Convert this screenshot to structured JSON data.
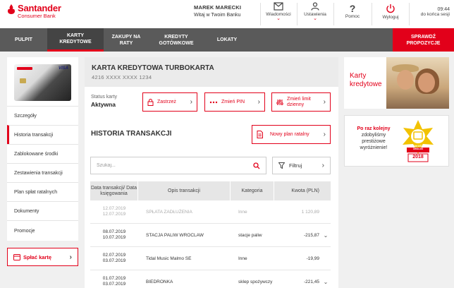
{
  "brand": {
    "name": "Santander",
    "subtitle": "Consumer Bank",
    "accent": "#e2001a"
  },
  "user": {
    "name": "MAREK MARECKI",
    "welcome": "Witaj w Twoim Banku"
  },
  "topbar": {
    "messages": "Wiadomości",
    "settings": "Ustawienia",
    "help": "Pomoc",
    "logout": "Wyloguj",
    "time": "09:44",
    "session_label": "do końca sesji"
  },
  "nav": {
    "items": [
      {
        "label": "PULPIT"
      },
      {
        "label": "KARTY KREDYTOWE"
      },
      {
        "label": "ZAKUPY NA RATY"
      },
      {
        "label": "KREDYTY GOTÓWKOWE"
      },
      {
        "label": "LOKATY"
      }
    ],
    "cta": "SPRAWDŹ PROPOZYCJE"
  },
  "sidebar": {
    "items": [
      {
        "label": "Szczegóły"
      },
      {
        "label": "Historia transakcji"
      },
      {
        "label": "Zablokowane środki"
      },
      {
        "label": "Zestawienia transakcji"
      },
      {
        "label": "Plan spłat ratalnych"
      },
      {
        "label": "Dokumenty"
      },
      {
        "label": "Promocje"
      }
    ],
    "repay_button": "Spłać kartę"
  },
  "card": {
    "title": "KARTA KREDYTOWA TURBOKARTA",
    "number": "4216 XXXX XXXX 1234",
    "status_label": "Status karty",
    "status_value": "Aktywna",
    "actions": {
      "block": "Zastrzeż",
      "pin": "Zmień PIN",
      "limit": "Zmień limit dzienny"
    }
  },
  "history": {
    "title": "HISTORIA TRANSAKCJI",
    "new_plan": "Nowy plan ratalny",
    "search_placeholder": "Szukaj...",
    "filter": "Filtruj",
    "columns": {
      "date": "Data transakcji/ Data księgowania",
      "desc": "Opis transakcji",
      "cat": "Kategoria",
      "amount": "Kwota (PLN)"
    },
    "rows": [
      {
        "date1": "12.07.2019",
        "date2": "12.07.2019",
        "desc": "SPŁATA ZADŁUŻENIA",
        "cat": "Inne",
        "amount": "1 120,89",
        "muted": true,
        "expand": ""
      },
      {
        "date1": "08.07.2019",
        "date2": "10.07.2019",
        "desc": "STACJA PALIW WROCLAW",
        "cat": "stacje paliw",
        "amount": "-215,87",
        "muted": false,
        "expand": "⌄"
      },
      {
        "date1": "02.07.2019",
        "date2": "03.07.2019",
        "desc": "Tidal Music Malmo SE",
        "cat": "Inne",
        "amount": "-19,99",
        "muted": false,
        "expand": ""
      },
      {
        "date1": "01.07.2019",
        "date2": "03.07.2019",
        "desc": "BIEDRONKA",
        "cat": "sklep spożywczy",
        "amount": "-221,45",
        "muted": false,
        "expand": "⌄"
      }
    ]
  },
  "promos": {
    "cards": "Karty kredytowe",
    "award_line1": "Po raz kolejny",
    "award_line2": "zdobyliśmy prestiżowe",
    "award_line3": "wyróżnienie!",
    "badge_text": "JAKOŚĆ OBSŁUGI",
    "badge_year": "2018"
  }
}
